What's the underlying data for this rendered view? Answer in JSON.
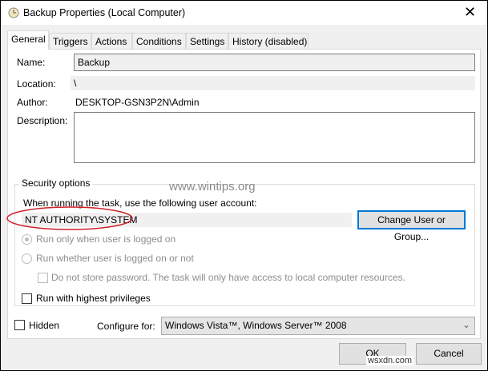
{
  "window": {
    "title": "Backup Properties (Local Computer)",
    "close_icon": "close-icon"
  },
  "tabs": [
    {
      "label": "General",
      "active": true
    },
    {
      "label": "Triggers"
    },
    {
      "label": "Actions"
    },
    {
      "label": "Conditions"
    },
    {
      "label": "Settings"
    },
    {
      "label": "History (disabled)"
    }
  ],
  "general": {
    "name_label": "Name:",
    "name_value": "Backup",
    "location_label": "Location:",
    "location_value": "\\",
    "author_label": "Author:",
    "author_value": "DESKTOP-GSN3P2N\\Admin",
    "description_label": "Description:",
    "description_value": ""
  },
  "security": {
    "title": "Security options",
    "account_prompt": "When running the task, use the following user account:",
    "account_value": "NT AUTHORITY\\SYSTEM",
    "change_button": "Change User or Group...",
    "radio_logged_on": "Run only when user is logged on",
    "radio_whether": "Run whether user is logged on or not",
    "no_store_password": "Do not store password.  The task will only have access to local computer resources.",
    "highest_privileges": "Run with highest privileges"
  },
  "hidden_label": "Hidden",
  "configure_label": "Configure for:",
  "configure_value": "Windows Vista™, Windows Server™ 2008",
  "ok_button": "OK",
  "cancel_button": "Cancel",
  "watermark": "www.wintips.org",
  "corner_watermark": "wsxdn.com",
  "colors": {
    "highlight_ellipse": "#d0202a",
    "focus_border": "#0078d7"
  }
}
